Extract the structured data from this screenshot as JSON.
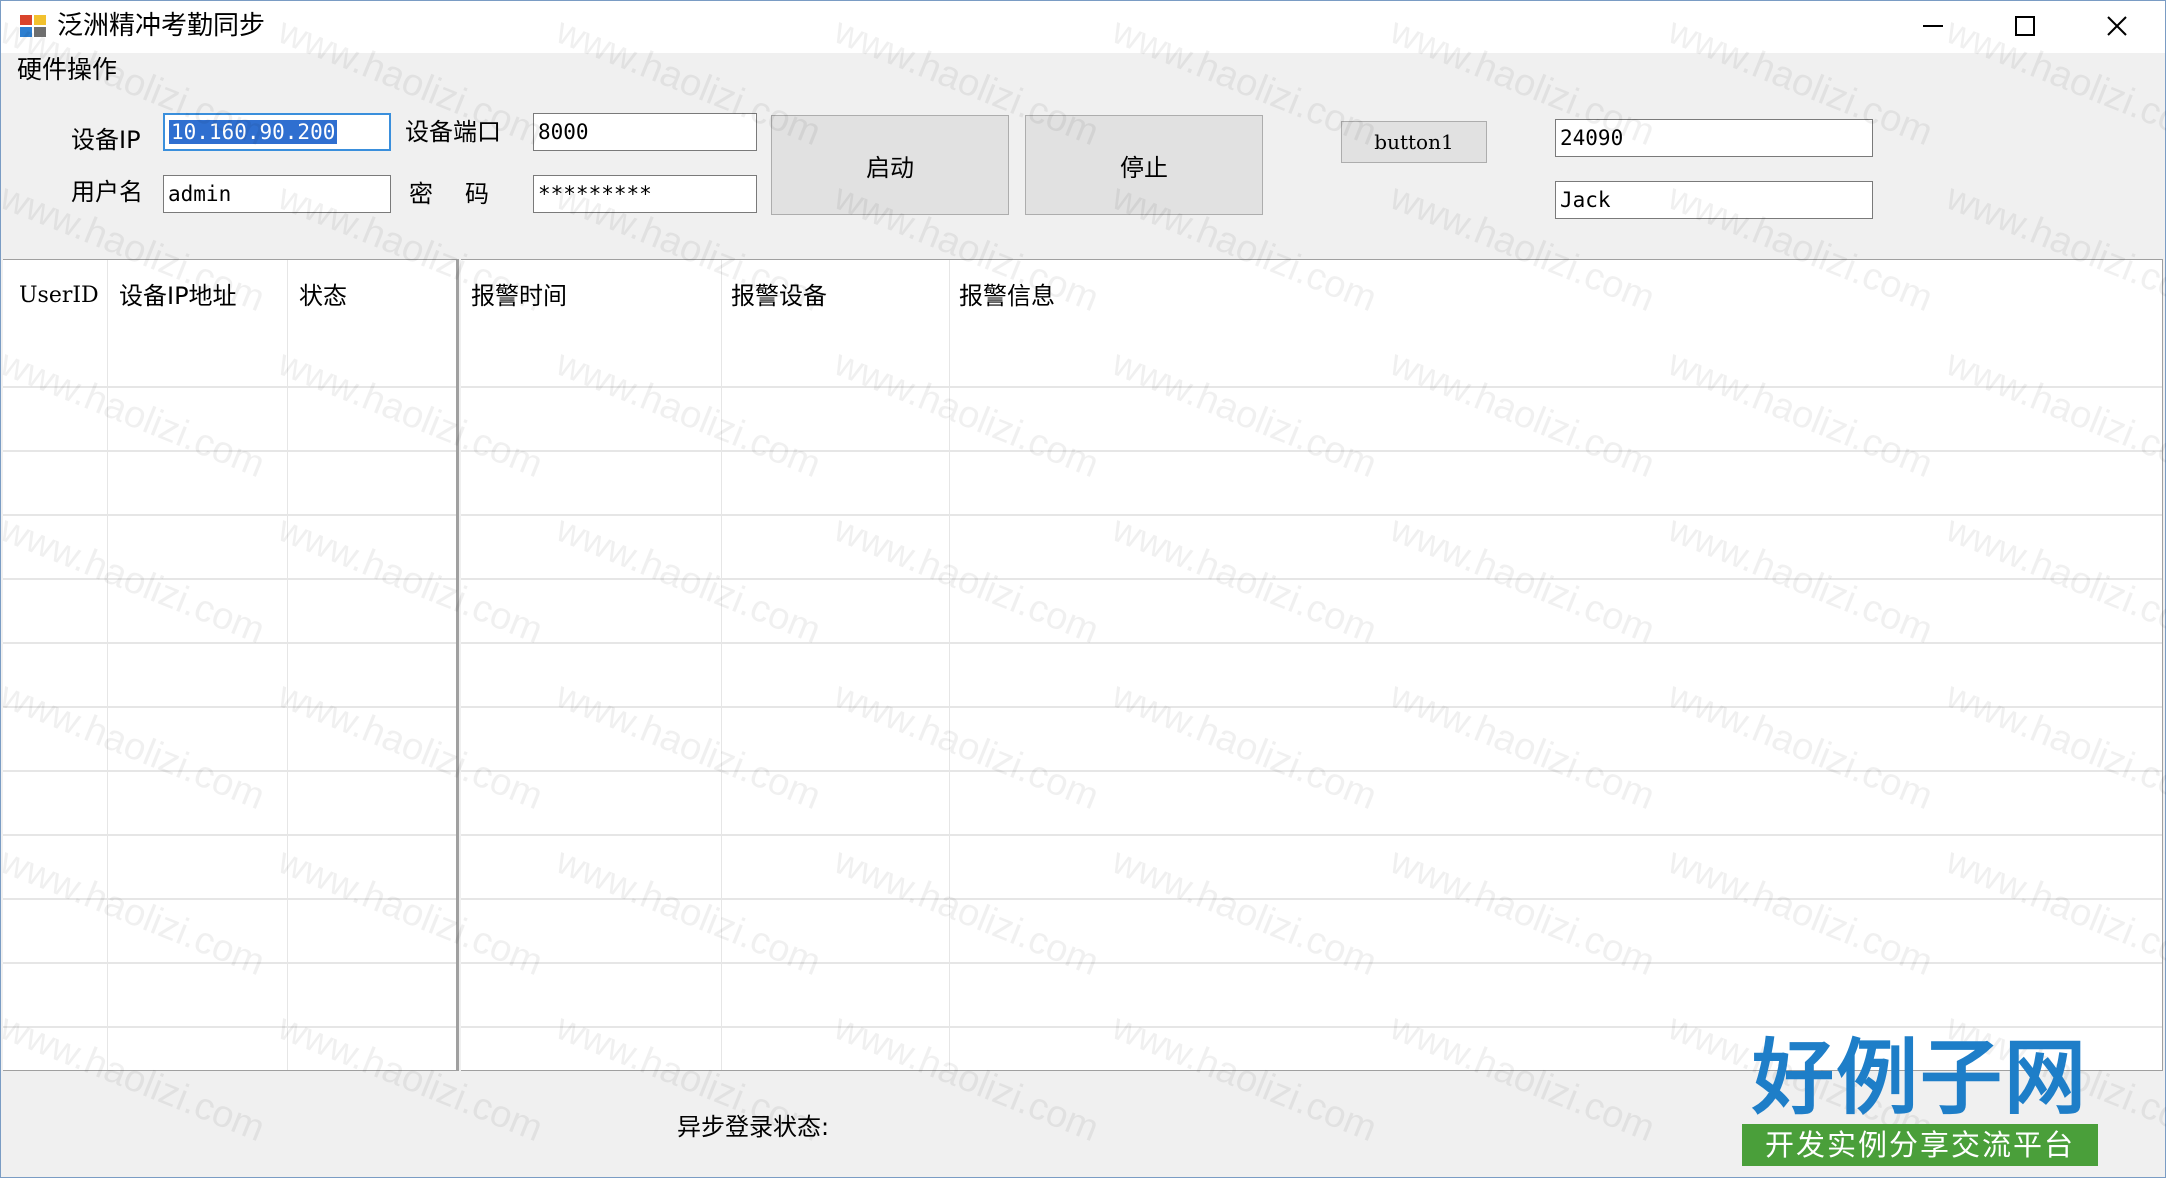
{
  "window": {
    "title": "泛洲精冲考勤同步",
    "minimize_icon": "minimize-icon",
    "maximize_icon": "maximize-icon",
    "close_icon": "close-icon"
  },
  "menu": {
    "items": [
      {
        "label": "硬件操作"
      }
    ]
  },
  "form": {
    "ip_label": "设备IP",
    "ip_value": "10.160.90.200",
    "port_label": "设备端口",
    "port_value": "8000",
    "user_label": "用户名",
    "user_value": "admin",
    "password_label": "密　码",
    "password_value": "*********",
    "start_label": "启动",
    "stop_label": "停止",
    "button1_label": "button1",
    "field1_value": "24090",
    "field2_value": "Jack"
  },
  "device_table": {
    "columns": [
      "UserID",
      "设备IP地址",
      "状态"
    ],
    "rows": []
  },
  "alarm_table": {
    "columns": [
      "报警时间",
      "报警设备",
      "报警信息"
    ],
    "rows": []
  },
  "status": {
    "label": "异步登录状态:"
  },
  "watermark": {
    "text": "www.haolizi.com"
  },
  "logo": {
    "title": "好例子网",
    "subtitle": "开发实例分享交流平台"
  },
  "colors": {
    "logo_blue": "#1e7ec8",
    "logo_green": "#4a9f3a",
    "focus_border": "#3a8fdc",
    "selection": "#2f6fd0"
  }
}
